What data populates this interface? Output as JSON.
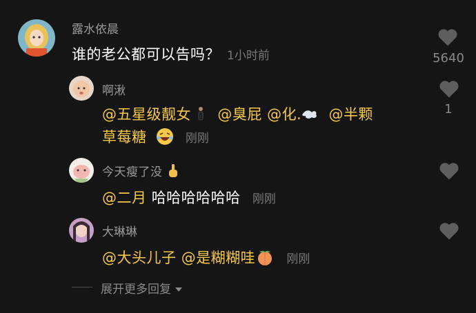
{
  "comment": {
    "username": "露水依晨",
    "text": "谁的老公都可以告吗？",
    "time": "1小时前",
    "like_count": "5640"
  },
  "replies": [
    {
      "username": "啊湫",
      "mentions": [
        "@五星级靓女",
        "@臭屁",
        "@化.",
        "@半颗",
        "草莓糖"
      ],
      "time": "刚刚",
      "like_count": "1"
    },
    {
      "username": "今天瘦了没",
      "mention": "@二月",
      "text": "哈哈哈哈哈哈",
      "time": "刚刚"
    },
    {
      "username": "大琳琳",
      "mentions": [
        "@大头儿子",
        "@是糊糊哇"
      ],
      "time": "刚刚"
    }
  ],
  "expand_label": "展开更多回复",
  "colors": {
    "background": "#151515",
    "mention": "#f5c84c",
    "text": "#ffffff",
    "muted": "#8a8a8a"
  }
}
